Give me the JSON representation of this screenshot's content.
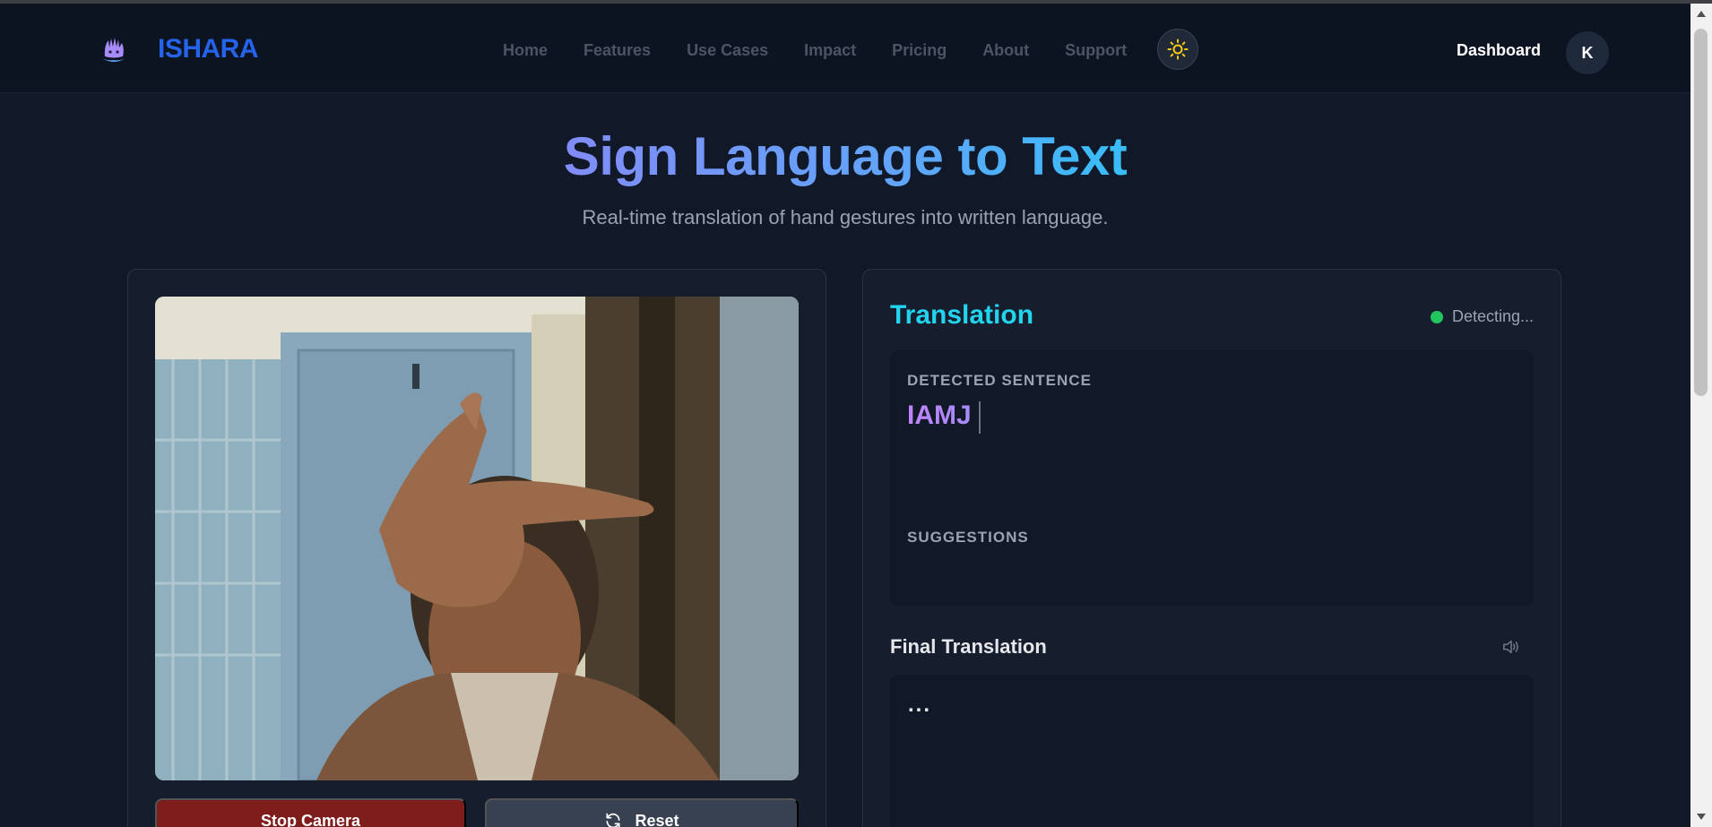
{
  "navbar": {
    "brand": "ISHARA",
    "links": [
      "Home",
      "Features",
      "Use Cases",
      "Impact",
      "Pricing",
      "About",
      "Support"
    ],
    "dashboard_label": "Dashboard",
    "avatar_initial": "K",
    "theme_icon": "sun-icon"
  },
  "hero": {
    "title": "Sign Language to Text",
    "subtitle": "Real-time translation of hand gestures into written language."
  },
  "camera": {
    "stop_label": "Stop Camera",
    "reset_label": "Reset",
    "reset_icon": "refresh-icon"
  },
  "translation": {
    "title": "Translation",
    "status": "Detecting...",
    "status_color": "#22c55e",
    "detected_label": "DETECTED SENTENCE",
    "detected_text": "IAMJ",
    "suggestions_label": "SUGGESTIONS",
    "final_title": "Final Translation",
    "final_text": "...",
    "speaker_icon": "speaker-icon"
  },
  "colors": {
    "brand": "#2563eb",
    "accent_cyan": "#22d3ee",
    "stop_button": "#7f1d1d",
    "background": "#111827"
  }
}
